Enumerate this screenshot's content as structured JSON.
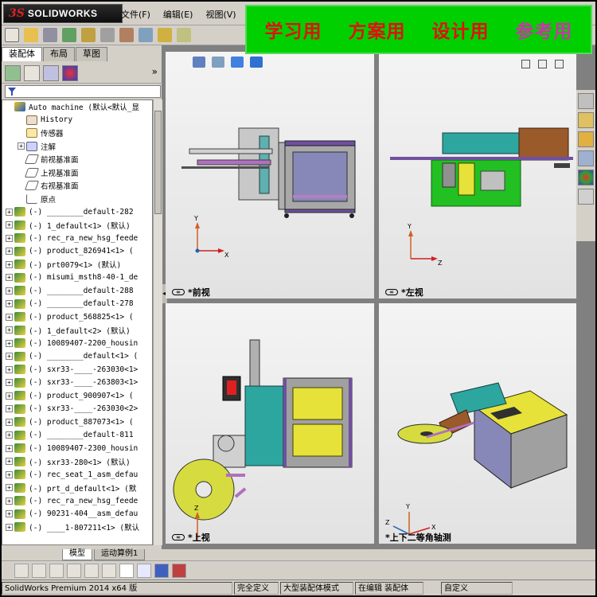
{
  "app": {
    "logo_ds": "3S",
    "logo_text": "SOLIDWORKS",
    "menu": [
      "文件(F)",
      "编辑(E)",
      "视图(V)"
    ]
  },
  "banner": {
    "items": [
      "学习用",
      "方案用",
      "设计用",
      "参考用"
    ]
  },
  "panel": {
    "tabs": [
      "装配体",
      "布局",
      "草图"
    ],
    "more": "»",
    "tree": [
      {
        "label": "Auto machine  (默认<默认_显",
        "icon": "root",
        "level": 0,
        "exp": ""
      },
      {
        "label": "History",
        "icon": "hist",
        "level": 1,
        "exp": ""
      },
      {
        "label": "传感器",
        "icon": "sens",
        "level": 1,
        "exp": ""
      },
      {
        "label": "注解",
        "icon": "note",
        "level": 1,
        "exp": "+"
      },
      {
        "label": "前视基准面",
        "icon": "plane",
        "level": 1,
        "exp": ""
      },
      {
        "label": "上视基准面",
        "icon": "plane",
        "level": 1,
        "exp": ""
      },
      {
        "label": "右视基准面",
        "icon": "plane",
        "level": 1,
        "exp": ""
      },
      {
        "label": "原点",
        "icon": "orig",
        "level": 1,
        "exp": ""
      },
      {
        "label": "(-) ________default-282",
        "icon": "asm",
        "level": 0,
        "exp": "+"
      },
      {
        "label": "(-) 1_default<1> (默认)",
        "icon": "asm",
        "level": 0,
        "exp": "+"
      },
      {
        "label": "(-) rec_ra_new_hsg_feede",
        "icon": "asm",
        "level": 0,
        "exp": "+"
      },
      {
        "label": "(-) product_826941<1> (",
        "icon": "asm",
        "level": 0,
        "exp": "+"
      },
      {
        "label": "(-) prt0079<1> (默认)",
        "icon": "asm",
        "level": 0,
        "exp": "+"
      },
      {
        "label": "(-) misumi_msth8-40-1_de",
        "icon": "asm",
        "level": 0,
        "exp": "+"
      },
      {
        "label": "(-) ________default-288",
        "icon": "asm",
        "level": 0,
        "exp": "+"
      },
      {
        "label": "(-) ________default-278",
        "icon": "asm",
        "level": 0,
        "exp": "+"
      },
      {
        "label": "(-) product_568825<1> (",
        "icon": "asm",
        "level": 0,
        "exp": "+"
      },
      {
        "label": "(-) 1_default<2> (默认)",
        "icon": "asm",
        "level": 0,
        "exp": "+"
      },
      {
        "label": "(-) 10089407-2200_housin",
        "icon": "asm",
        "level": 0,
        "exp": "+"
      },
      {
        "label": "(-) ________default<1> (",
        "icon": "asm",
        "level": 0,
        "exp": "+"
      },
      {
        "label": "(-) sxr33-____-263030<1>",
        "icon": "asm",
        "level": 0,
        "exp": "+"
      },
      {
        "label": "(-) sxr33-____-263803<1>",
        "icon": "asm",
        "level": 0,
        "exp": "+"
      },
      {
        "label": "(-) product_900907<1> (",
        "icon": "asm",
        "level": 0,
        "exp": "+"
      },
      {
        "label": "(-) sxr33-____-263030<2>",
        "icon": "asm",
        "level": 0,
        "exp": "+"
      },
      {
        "label": "(-) product_887073<1> (",
        "icon": "asm",
        "level": 0,
        "exp": "+"
      },
      {
        "label": "(-) ________default-811",
        "icon": "asm",
        "level": 0,
        "exp": "+"
      },
      {
        "label": "(-) 10089407-2300_housin",
        "icon": "asm",
        "level": 0,
        "exp": "+"
      },
      {
        "label": "(-) sxr33-280<1> (默认)",
        "icon": "asm",
        "level": 0,
        "exp": "+"
      },
      {
        "label": "(-) rec_seat_1_asm_defau",
        "icon": "asm",
        "level": 0,
        "exp": "+"
      },
      {
        "label": "(-) prt_d_default<1> (默",
        "icon": "asm",
        "level": 0,
        "exp": "+"
      },
      {
        "label": "(-) rec_ra_new_hsg_feede",
        "icon": "asm",
        "level": 0,
        "exp": "+"
      },
      {
        "label": "(-) 90231-404__asm_defau",
        "icon": "asm",
        "level": 0,
        "exp": "+"
      },
      {
        "label": "(-) ____1-807211<1> (默认",
        "icon": "asm",
        "level": 0,
        "exp": "+"
      }
    ]
  },
  "bottom_tabs": [
    "模型",
    "运动算例1"
  ],
  "views": {
    "front": "*前视",
    "left": "*左视",
    "top": "*上视",
    "iso": "*上下二等角轴测",
    "eye": "∞"
  },
  "axes": {
    "x": "X",
    "y": "Y",
    "z": "Z"
  },
  "status": [
    "SolidWorks Premium 2014 x64 版",
    "完全定义",
    "大型装配体模式",
    "在编辑 装配体",
    "自定义"
  ],
  "colors": {
    "banner_bg": "#00d000",
    "banner_text": "#e01010",
    "banner_ref": "#c33aa0",
    "teal": "#2ea6a0",
    "yellow": "#e6e23a",
    "purple": "#7a4aa8",
    "green_base": "#22c022"
  }
}
